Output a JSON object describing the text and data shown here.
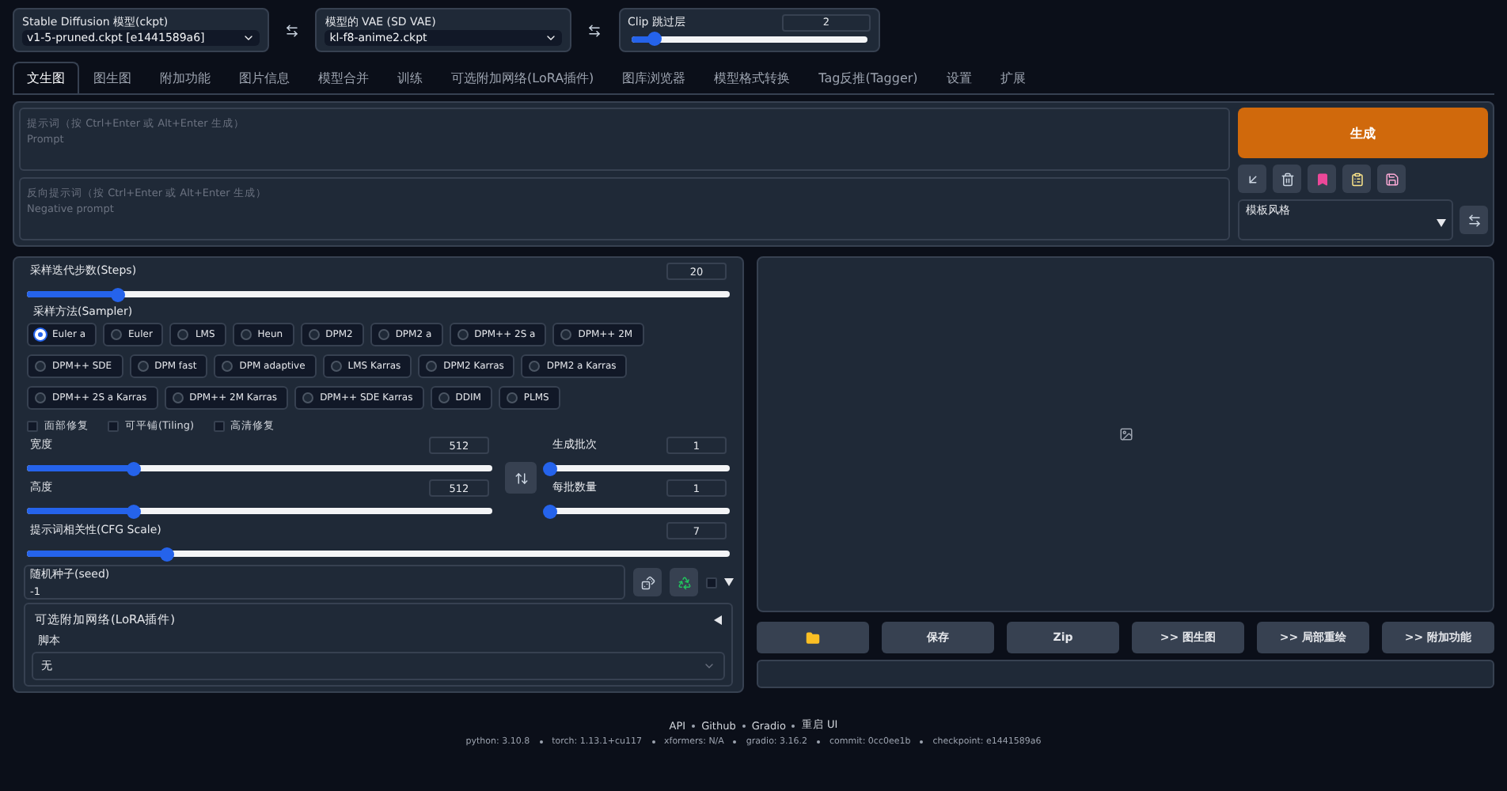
{
  "top_bar": {
    "checkpoint": {
      "label": "Stable Diffusion 模型(ckpt)",
      "value": "v1-5-pruned.ckpt [e1441589a6]"
    },
    "vae": {
      "label": "模型的 VAE (SD VAE)",
      "value": "kl-f8-anime2.ckpt"
    },
    "clip": {
      "label": "Clip 跳过层",
      "value": "2",
      "level": 0.1
    }
  },
  "tabs": [
    {
      "label": "文生图",
      "selected": true
    },
    {
      "label": "图生图",
      "selected": false
    },
    {
      "label": "附加功能",
      "selected": false
    },
    {
      "label": "图片信息",
      "selected": false
    },
    {
      "label": "模型合并",
      "selected": false
    },
    {
      "label": "训练",
      "selected": false
    },
    {
      "label": "可选附加网络(LoRA插件)",
      "selected": false
    },
    {
      "label": "图库浏览器",
      "selected": false
    },
    {
      "label": "模型格式转换",
      "selected": false
    },
    {
      "label": "Tag反推(Tagger)",
      "selected": false
    },
    {
      "label": "设置",
      "selected": false
    },
    {
      "label": "扩展",
      "selected": false
    }
  ],
  "prompt": {
    "placeholder": "提示词（按 Ctrl+Enter 或 Alt+Enter 生成）\nPrompt"
  },
  "negative_prompt": {
    "placeholder": "反向提示词（按 Ctrl+Enter 或 Alt+Enter 生成）\nNegative prompt"
  },
  "generate_button": "生成",
  "style": {
    "label": "模板风格"
  },
  "steps": {
    "label": "采样迭代步数(Steps)",
    "value": "20",
    "level": 0.13
  },
  "sampler": {
    "label": "采样方法(Sampler)",
    "options": [
      {
        "label": "Euler a",
        "selected": true
      },
      {
        "label": "Euler",
        "selected": false
      },
      {
        "label": "LMS",
        "selected": false
      },
      {
        "label": "Heun",
        "selected": false
      },
      {
        "label": "DPM2",
        "selected": false
      },
      {
        "label": "DPM2 a",
        "selected": false
      },
      {
        "label": "DPM++ 2S a",
        "selected": false
      },
      {
        "label": "DPM++ 2M",
        "selected": false
      },
      {
        "label": "DPM++ SDE",
        "selected": false
      },
      {
        "label": "DPM fast",
        "selected": false
      },
      {
        "label": "DPM adaptive",
        "selected": false
      },
      {
        "label": "LMS Karras",
        "selected": false
      },
      {
        "label": "DPM2 Karras",
        "selected": false
      },
      {
        "label": "DPM2 a Karras",
        "selected": false
      },
      {
        "label": "DPM++ 2S a Karras",
        "selected": false
      },
      {
        "label": "DPM++ 2M Karras",
        "selected": false
      },
      {
        "label": "DPM++ SDE Karras",
        "selected": false
      },
      {
        "label": "DDIM",
        "selected": false
      },
      {
        "label": "PLMS",
        "selected": false
      }
    ]
  },
  "options": [
    {
      "label": "面部修复",
      "checked": false
    },
    {
      "label": "可平铺(Tiling)",
      "checked": false
    },
    {
      "label": "高清修复",
      "checked": false
    }
  ],
  "width": {
    "label": "宽度",
    "value": "512",
    "level": 0.23
  },
  "height": {
    "label": "高度",
    "value": "512",
    "level": 0.23
  },
  "batch_count": {
    "label": "生成批次",
    "value": "1",
    "level": 0
  },
  "batch_size": {
    "label": "每批数量",
    "value": "1",
    "level": 0
  },
  "cfg": {
    "label": "提示词相关性(CFG Scale)",
    "value": "7",
    "level": 0.2
  },
  "seed": {
    "label": "随机种子(seed)",
    "value": "-1",
    "extra_checked": false
  },
  "lora_section": {
    "label": "可选附加网络(LoRA插件)",
    "expanded": false
  },
  "script": {
    "label": "脚本",
    "value": "无"
  },
  "output_buttons": [
    {
      "kind": "folder"
    },
    {
      "kind": "text",
      "label": "保存"
    },
    {
      "kind": "text",
      "label": "Zip"
    },
    {
      "kind": "text",
      "label": ">> 图生图"
    },
    {
      "kind": "text",
      "label": ">> 局部重绘"
    },
    {
      "kind": "text",
      "label": ">> 附加功能"
    }
  ],
  "footer": {
    "links": [
      "API",
      "Github",
      "Gradio",
      "重启 UI"
    ],
    "versions": [
      "python: 3.10.8",
      "torch: 1.13.1+cu117",
      "xformers: N/A",
      "gradio: 3.16.2",
      "commit: 0cc0ee1b",
      "checkpoint: e1441589a6"
    ]
  }
}
